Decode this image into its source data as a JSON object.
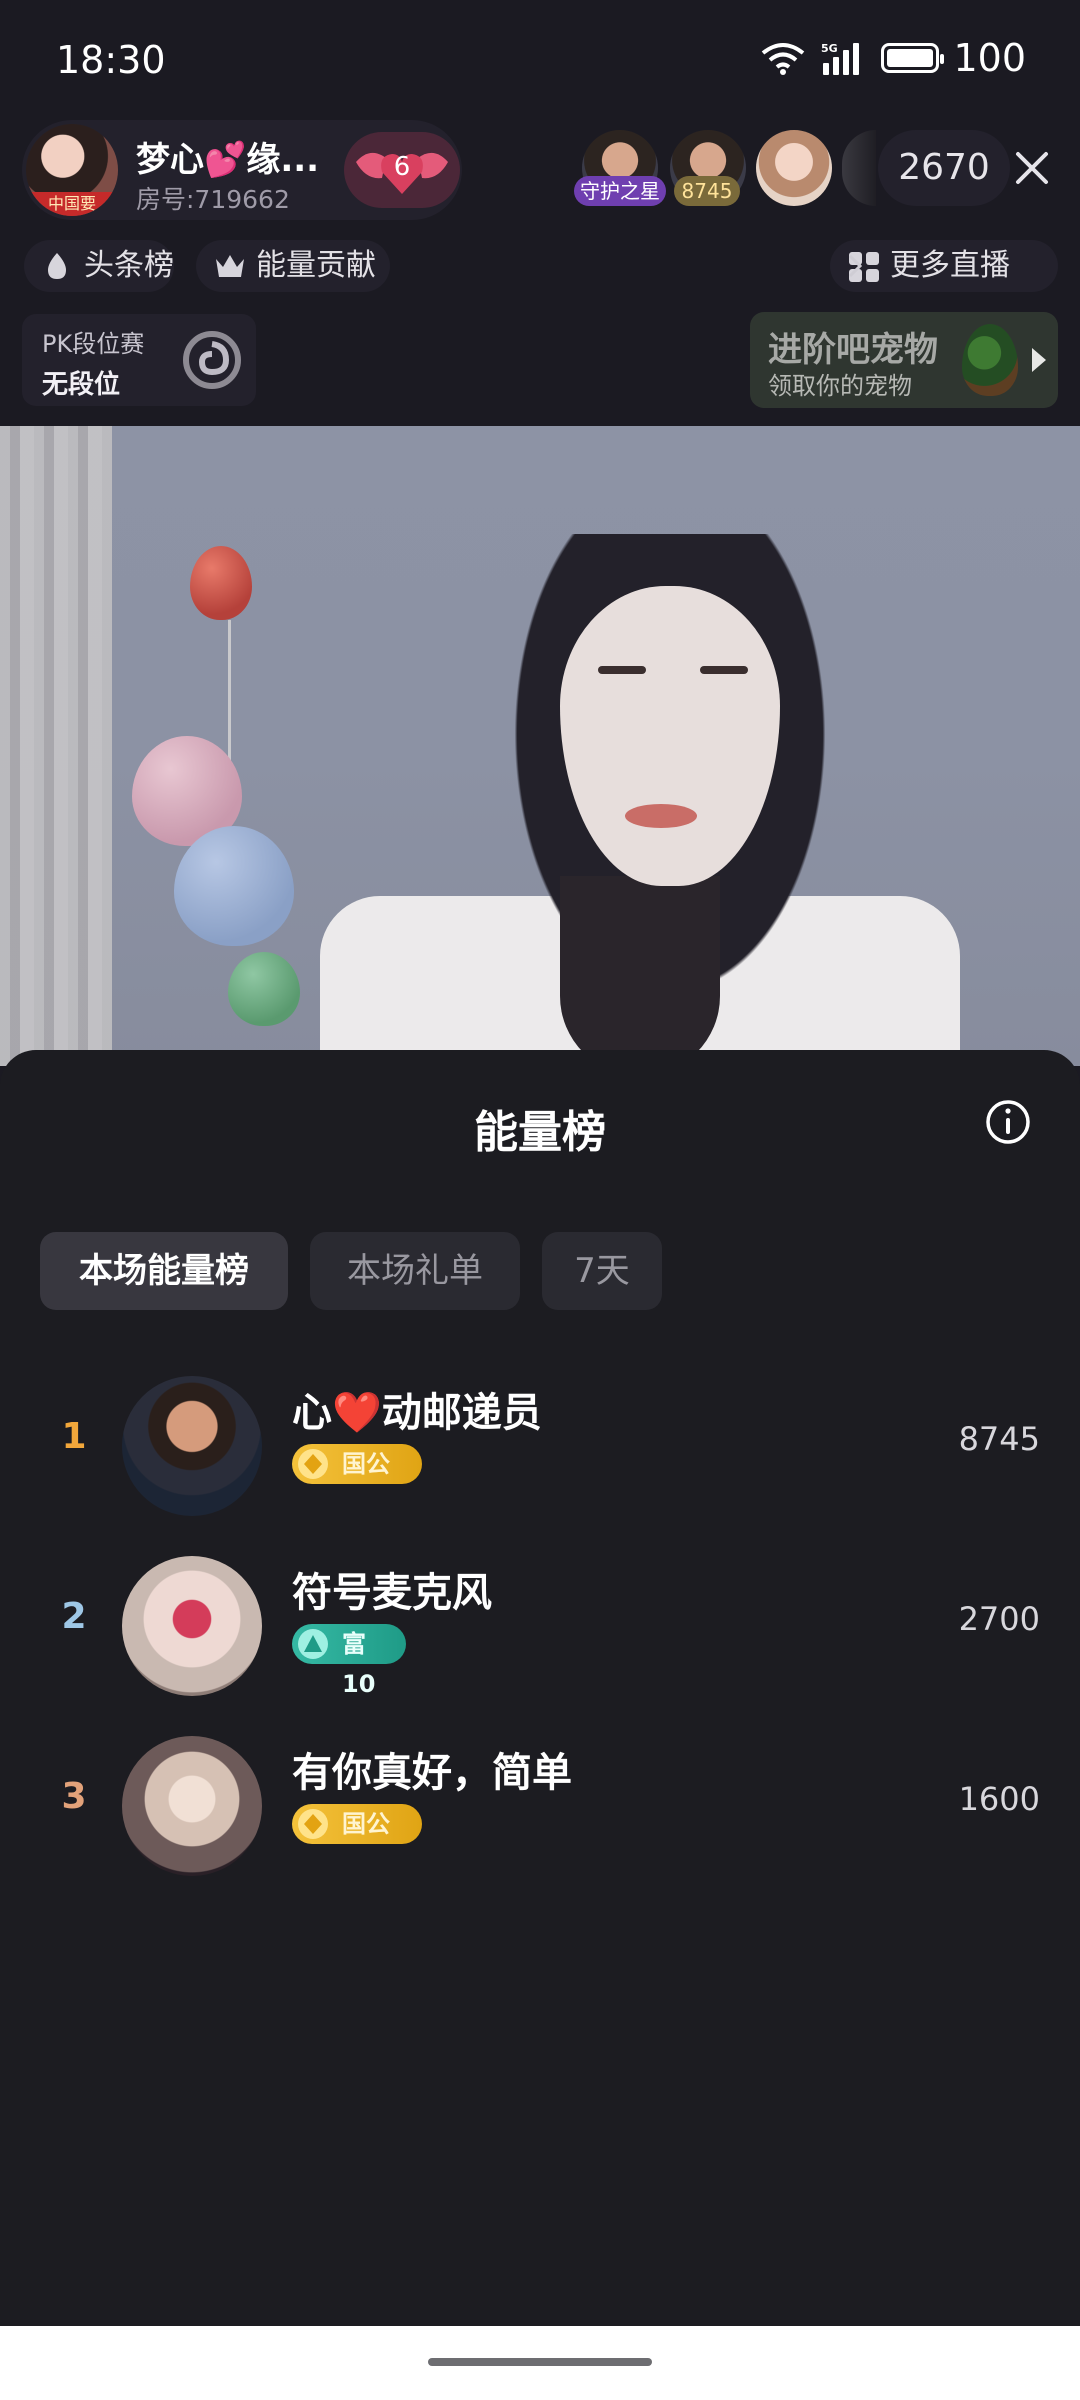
{
  "status_bar": {
    "time": "18:30",
    "battery": "100",
    "network": "5G"
  },
  "host": {
    "name": "梦心💕缘...",
    "room": "房号:719662",
    "avatar_tag": "中国要",
    "badge_level": "6"
  },
  "viewers": {
    "tag_1": "守护之星",
    "tag_2": "8745",
    "count": "2670"
  },
  "nav_chips": {
    "headlines": "头条榜",
    "energy_contrib": "能量贡献",
    "more_live": "更多直播"
  },
  "pk": {
    "title": "PK段位赛",
    "rank": "无段位"
  },
  "pet": {
    "title": "进阶吧宠物",
    "subtitle": "领取你的宠物"
  },
  "sheet": {
    "title": "能量榜",
    "tabs": [
      "本场能量榜",
      "本场礼单",
      "7天"
    ],
    "ranking": [
      {
        "rank": "1",
        "name": "心❤️动邮递员",
        "badge": "国公",
        "score": "8745"
      },
      {
        "rank": "2",
        "name": "符号麦克风",
        "badge": "富10",
        "score": "2700"
      },
      {
        "rank": "3",
        "name": "有你真好，简单",
        "badge": "国公",
        "score": "1600"
      }
    ]
  },
  "colors": {
    "rank_1": "#f2a73b",
    "rank_2": "#9ec7e6",
    "rank_3": "#e2a27a",
    "accent_gold": "#f4c23b",
    "accent_teal": "#35b9a4"
  },
  "icons": [
    "wifi-icon",
    "signal-icon",
    "battery-icon",
    "close-icon",
    "flame-icon",
    "crown-icon",
    "grid-icon",
    "chevron-right-icon",
    "info-icon",
    "diamond-icon",
    "triangle-icon"
  ]
}
